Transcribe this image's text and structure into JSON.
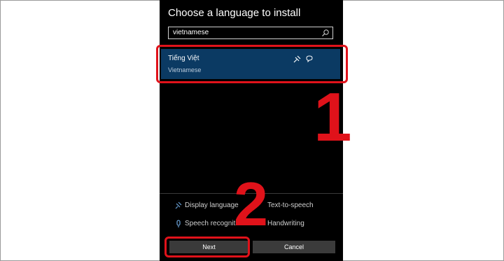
{
  "dialog": {
    "title": "Choose a language to install",
    "search": {
      "value": "vietnamese"
    },
    "language": {
      "name": "Tiếng Việt",
      "subtitle": "Vietnamese"
    },
    "features": {
      "display_language": "Display language",
      "text_to_speech": "Text-to-speech",
      "speech_recognition": "Speech recognitio",
      "handwriting": "Handwriting"
    },
    "buttons": {
      "next": "Next",
      "cancel": "Cancel"
    }
  },
  "annotations": {
    "step1": "1",
    "step2": "2"
  },
  "colors": {
    "highlight": "#0b3a63",
    "annotation_red": "#e0121a"
  }
}
